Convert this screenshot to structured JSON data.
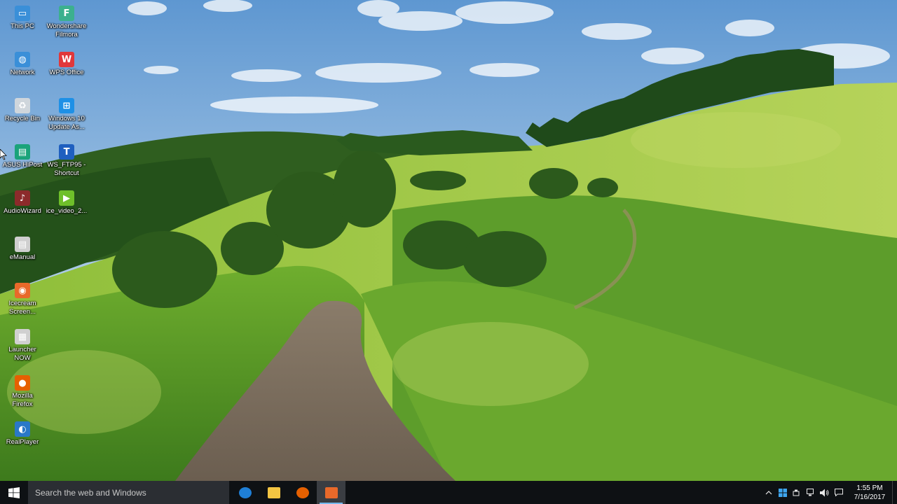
{
  "desktop": {
    "icons": [
      {
        "label": "This PC",
        "icon": "this-pc-icon",
        "color": "#3a8fd8",
        "glyph": "▭"
      },
      {
        "label": "Wondershare\nFilmora",
        "icon": "filmora-icon",
        "color": "#3cb08e",
        "glyph": "F"
      },
      {
        "label": "Network",
        "icon": "network-icon",
        "color": "#3a8fd8",
        "glyph": "◍"
      },
      {
        "label": "WPS Office",
        "icon": "wps-office-icon",
        "color": "#e0383b",
        "glyph": "W"
      },
      {
        "label": "Recycle Bin",
        "icon": "recycle-bin-icon",
        "color": "#cfd6dc",
        "glyph": "♻"
      },
      {
        "label": "Windows 10\nUpdate As...",
        "icon": "windows-update-icon",
        "color": "#1e90e6",
        "glyph": "⊞"
      },
      {
        "label": "ASUS HiPost",
        "icon": "asus-hipost-icon",
        "color": "#1aa37a",
        "glyph": "▤"
      },
      {
        "label": "WS_FTP95 -\nShortcut",
        "icon": "ws-ftp-icon",
        "color": "#1f5fbf",
        "glyph": "T"
      },
      {
        "label": "AudioWizard",
        "icon": "audiowizard-icon",
        "color": "#8c2b2b",
        "glyph": "♪"
      },
      {
        "label": "ice_video_2...",
        "icon": "video-file-icon",
        "color": "#6fbf2a",
        "glyph": "▶"
      },
      {
        "label": "eManual",
        "icon": "emanual-icon",
        "color": "#cfcfcf",
        "glyph": "▤"
      },
      {
        "label": "Icecream\nScreen...",
        "icon": "icecream-screen-icon",
        "color": "#e8692a",
        "glyph": "◉"
      },
      {
        "label": "Launcher\nNOW",
        "icon": "launcher-now-icon",
        "color": "#d0d0d0",
        "glyph": "▦"
      },
      {
        "label": "Mozilla\nFirefox",
        "icon": "firefox-icon",
        "color": "#e66000",
        "glyph": "●"
      },
      {
        "label": "RealPlayer",
        "icon": "realplayer-icon",
        "color": "#2a78c8",
        "glyph": "◐"
      }
    ]
  },
  "taskbar": {
    "search_placeholder": "Search the web and Windows",
    "apps": [
      {
        "name": "Microsoft Edge",
        "icon": "edge-icon",
        "color": "#1f7fd6",
        "running": false,
        "active": false
      },
      {
        "name": "File Explorer",
        "icon": "file-explorer-icon",
        "color": "#f4c542",
        "running": false,
        "active": false
      },
      {
        "name": "Mozilla Firefox",
        "icon": "firefox-icon",
        "color": "#e66000",
        "running": false,
        "active": false
      },
      {
        "name": "Icecream Screen Recorder",
        "icon": "icecream-screen-icon",
        "color": "#e8692a",
        "running": true,
        "active": true
      }
    ],
    "tray": {
      "time": "1:55 PM",
      "date": "7/16/2017",
      "icons": [
        "chevron-up-icon",
        "windows-defender-icon",
        "usb-icon",
        "network-icon",
        "volume-icon"
      ]
    }
  },
  "colors": {
    "taskbar": "#0e1114",
    "search_box": "#2b2e33",
    "accent": "#76b9ed"
  }
}
